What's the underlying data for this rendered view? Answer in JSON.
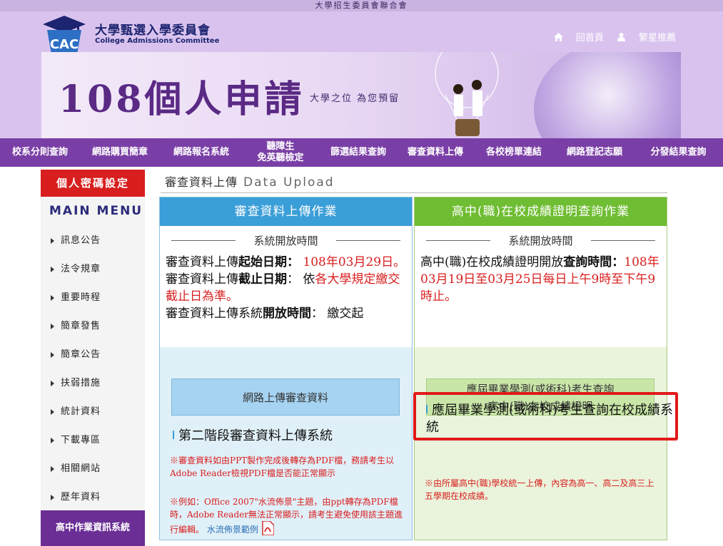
{
  "topbar": "大學招生委員會聯合會",
  "header": {
    "logo_cn": "大學甄選入學委員會",
    "logo_en": "College Admissions Committee",
    "home": "回首頁",
    "star": "繁星推薦",
    "banner_title": "108個人申請",
    "banner_sub": "大學之位 為您預留"
  },
  "nav": [
    "校系分則查詢",
    "網路購買簡章",
    "網路報名系統",
    "聽障生\n免英聽檢定",
    "篩選結果查詢",
    "審查資料上傳",
    "各校榜單連結",
    "網路登記志願",
    "分發結果查詢"
  ],
  "sidebar": {
    "password": "個人密碼設定",
    "main_menu": "MAIN MENU",
    "items": [
      "訊息公告",
      "法令規章",
      "重要時程",
      "簡章發售",
      "簡章公告",
      "扶弱措施",
      "統計資料",
      "下載專區",
      "相關網站",
      "歷年資料"
    ],
    "bottom": "高中作業資訊系統"
  },
  "content": {
    "title": "審查資料上傳",
    "title_en": "Data Upload",
    "left": {
      "head": "審查資料上傳作業",
      "sys_time": "系統開放時間",
      "l1a": "審查資料上傳",
      "l1b": "起始日期",
      "l1c": "：",
      "l1d": "108年03月29日。",
      "l2a": "審查資料上傳",
      "l2b": "截止日期",
      "l2c": "： 依",
      "l2d": "各大學規定繳交截止日為準。",
      "l3a": "審查資料上傳系統",
      "l3b": "開放時間",
      "l3c": "： 繳交起",
      "btn": "網路上傳審查資料",
      "link": "第二階段審查資料上傳系統",
      "note1a": "※審查資料如由PPT製作完成後轉存為PDF檔，務請考生以Adobe Reader檢視PDF檔是否能正常顯示",
      "note2a": "※例如：Office 2007\"水流佈景\"主題，由ppt轉存為PDF檔時，Adobe Reader無法正常顯示，請考生避免使用該主題進行編輯。",
      "note2b": "水流佈景範例"
    },
    "right": {
      "head": "高中(職)在校成績證明查詢作業",
      "sys_time": "系統開放時間",
      "l1a": "高中(職)在校成績證明開放",
      "l1b": "查詢時間",
      "l1c": "：",
      "l1d": "108年03月19日至03月25日每日上午9時至下午9時止。",
      "btn1": "應屆畢業學測(或術科)考生查詢",
      "btn2": "高中(職)在校成績證明",
      "link": "應屆畢業學測(或術科)考生查詢在校成績系統",
      "note": "※由所屬高中(職)學校統一上傳，內容為高一、高二及高三上五學期在校成績。"
    }
  },
  "colors": {
    "nav": "#7a3fa6",
    "accent_red": "#d81e1e",
    "blue_head": "#3a9ed8",
    "green_head": "#6fbd32"
  }
}
